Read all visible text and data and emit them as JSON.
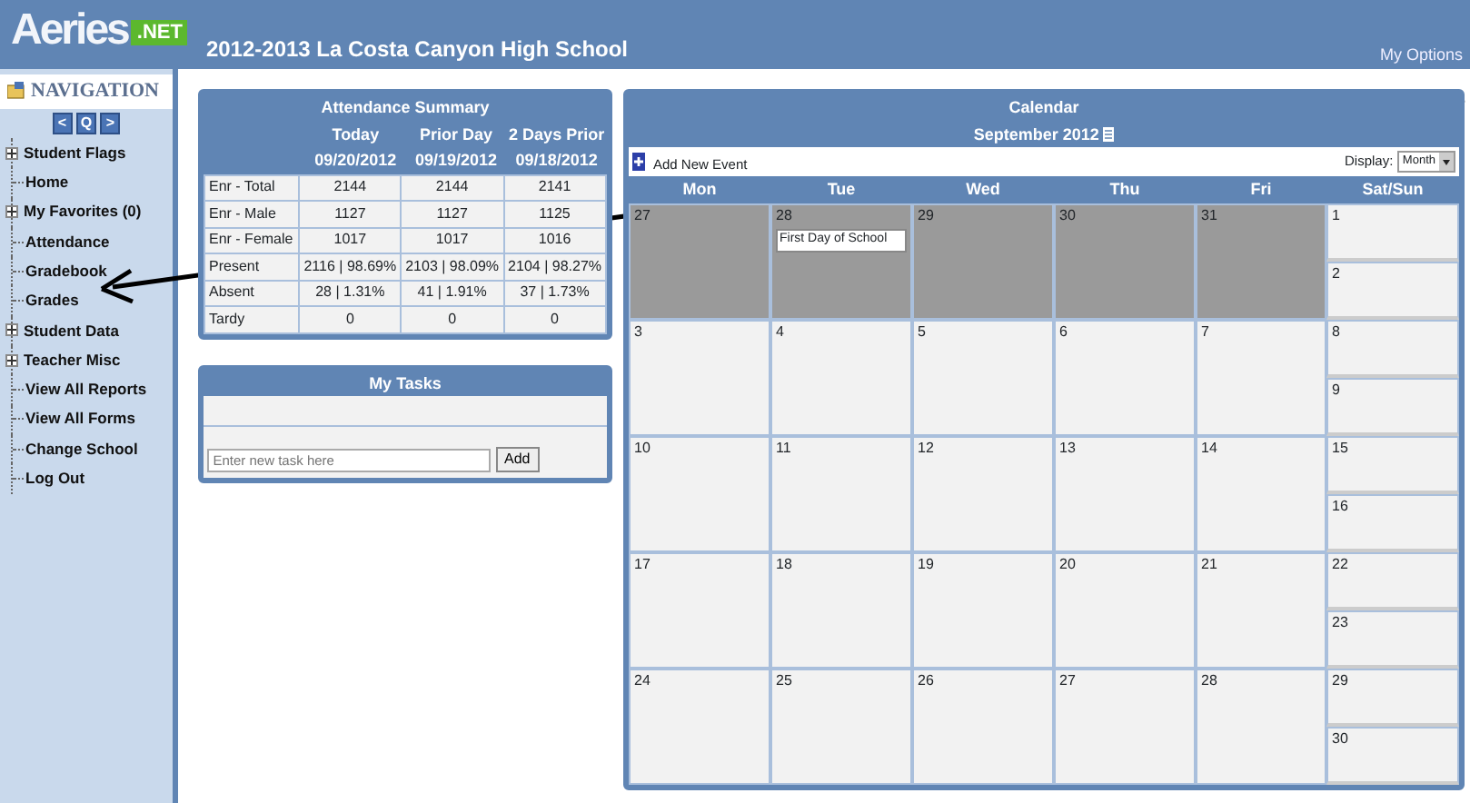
{
  "header": {
    "logo": "Aeries",
    "logo_badge": ".NET",
    "school": "2012-2013 La Costa Canyon High School",
    "link": "My Options"
  },
  "navigation": {
    "title": "NAVIGATION",
    "buttons": [
      "<",
      "Q",
      ">"
    ],
    "items": [
      {
        "label": "Student Flags",
        "kind": "group"
      },
      {
        "label": "Home",
        "kind": "leaf"
      },
      {
        "label": "My Favorites (0)",
        "kind": "group"
      },
      {
        "label": "Attendance",
        "kind": "leaf"
      },
      {
        "label": "Gradebook",
        "kind": "leaf"
      },
      {
        "label": "Grades",
        "kind": "leaf"
      },
      {
        "label": "Student Data",
        "kind": "group"
      },
      {
        "label": "Teacher Misc",
        "kind": "group"
      },
      {
        "label": "View All Reports",
        "kind": "leaf"
      },
      {
        "label": "View All Forms",
        "kind": "leaf"
      },
      {
        "label": "Change School",
        "kind": "leaf"
      },
      {
        "label": "Log Out",
        "kind": "leaf"
      }
    ]
  },
  "attendance": {
    "title": "Attendance Summary",
    "columns": [
      {
        "label": "Today",
        "date": "09/20/2012"
      },
      {
        "label": "Prior Day",
        "date": "09/19/2012"
      },
      {
        "label": "2 Days Prior",
        "date": "09/18/2012"
      }
    ],
    "rows": [
      {
        "label": "Enr - Total",
        "values": [
          "2144",
          "2144",
          "2141"
        ]
      },
      {
        "label": "Enr - Male",
        "values": [
          "1127",
          "1127",
          "1125"
        ]
      },
      {
        "label": "Enr - Female",
        "values": [
          "1017",
          "1017",
          "1016"
        ]
      },
      {
        "label": "Present",
        "values": [
          "2116 | 98.69%",
          "2103 | 98.09%",
          "2104 | 98.27%"
        ]
      },
      {
        "label": "Absent",
        "values": [
          "28 | 1.31%",
          "41 | 1.91%",
          "37 | 1.73%"
        ]
      },
      {
        "label": "Tardy",
        "values": [
          "0",
          "0",
          "0"
        ]
      }
    ]
  },
  "tasks": {
    "title": "My Tasks",
    "placeholder": "Enter new task here",
    "button": "Add"
  },
  "calendar": {
    "title": "Calendar",
    "month": "September 2012",
    "add_event": "Add New Event",
    "display_label": "Display:",
    "display_value": "Month",
    "weekday_headers": [
      "Mon",
      "Tue",
      "Wed",
      "Thu",
      "Fri",
      "Sat/Sun"
    ],
    "weeks": [
      {
        "days": [
          {
            "day": "27",
            "outside_month": true
          },
          {
            "day": "28",
            "outside_month": true,
            "events": [
              "First Day of School"
            ]
          },
          {
            "day": "29",
            "outside_month": true
          },
          {
            "day": "30",
            "outside_month": true
          },
          {
            "day": "31",
            "outside_month": true
          }
        ],
        "weekend": [
          "1",
          "2"
        ]
      },
      {
        "days": [
          {
            "day": "3",
            "outside_month": false
          },
          {
            "day": "4",
            "outside_month": false
          },
          {
            "day": "5",
            "outside_month": false
          },
          {
            "day": "6",
            "outside_month": false
          },
          {
            "day": "7",
            "outside_month": false
          }
        ],
        "weekend": [
          "8",
          "9"
        ]
      },
      {
        "days": [
          {
            "day": "10",
            "outside_month": false
          },
          {
            "day": "11",
            "outside_month": false
          },
          {
            "day": "12",
            "outside_month": false
          },
          {
            "day": "13",
            "outside_month": false
          },
          {
            "day": "14",
            "outside_month": false
          }
        ],
        "weekend": [
          "15",
          "16"
        ]
      },
      {
        "days": [
          {
            "day": "17",
            "outside_month": false
          },
          {
            "day": "18",
            "outside_month": false
          },
          {
            "day": "19",
            "outside_month": false
          },
          {
            "day": "20",
            "outside_month": false
          },
          {
            "day": "21",
            "outside_month": false
          }
        ],
        "weekend": [
          "22",
          "23"
        ]
      },
      {
        "days": [
          {
            "day": "24",
            "outside_month": false
          },
          {
            "day": "25",
            "outside_month": false
          },
          {
            "day": "26",
            "outside_month": false
          },
          {
            "day": "27",
            "outside_month": false
          },
          {
            "day": "28",
            "outside_month": false
          }
        ],
        "weekend": [
          "29",
          "30"
        ]
      }
    ]
  }
}
